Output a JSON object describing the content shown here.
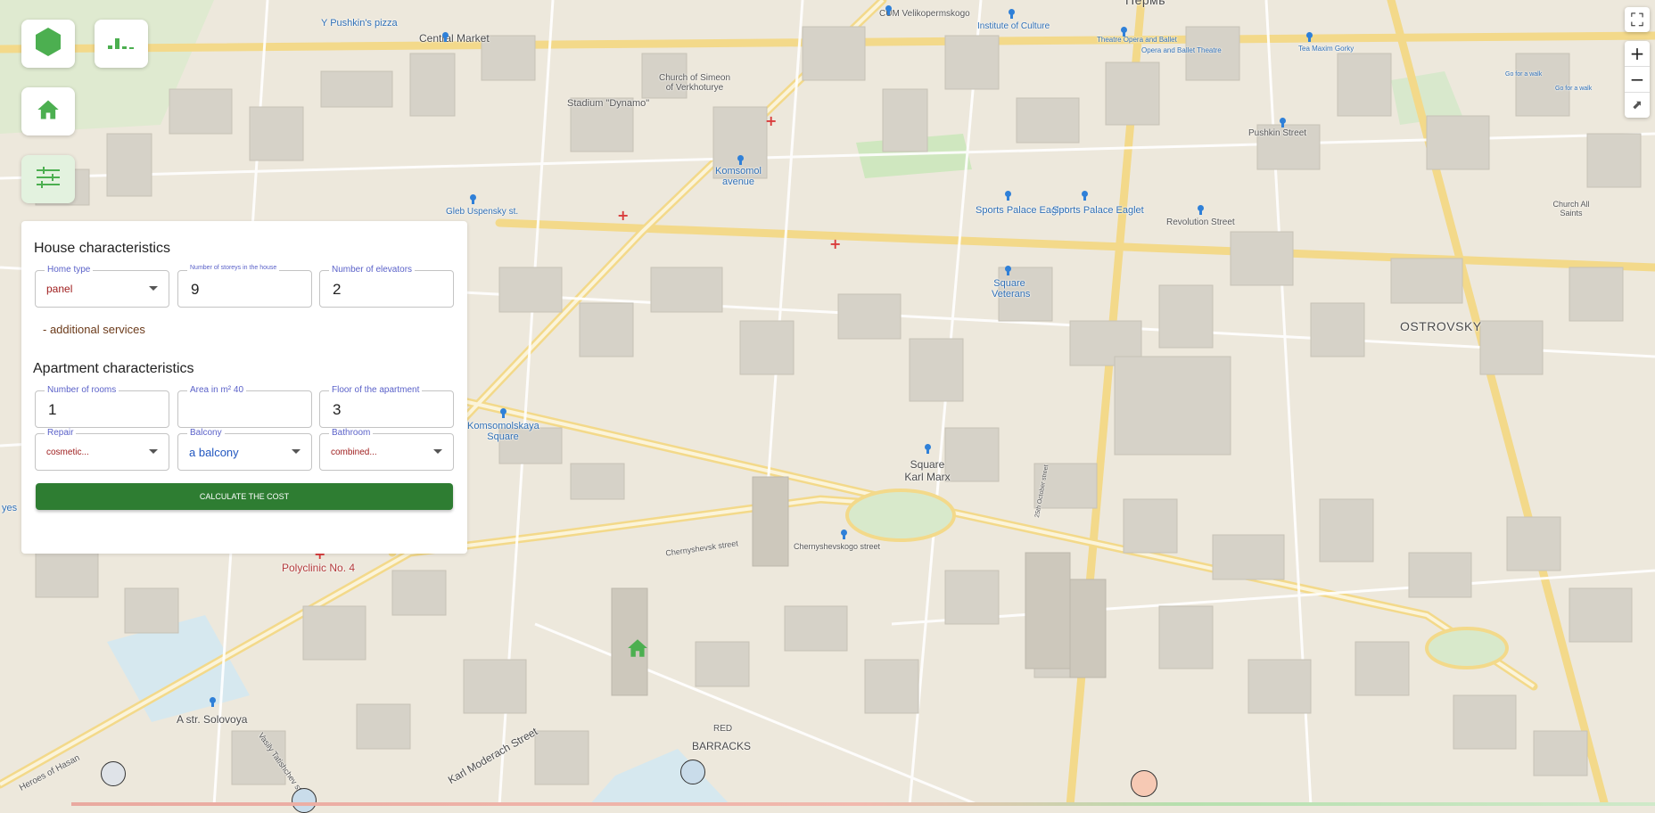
{
  "map": {
    "labels": {
      "yushkins_pizza": "Y Pushkin's pizza",
      "central_market": "Central Market",
      "cum": "CUM Velikopermskogo",
      "institute_culture": "Institute of Culture",
      "opera": "Theatre Opera and Ballet",
      "opera_ballet": "Opera and Ballet Theatre",
      "tea_maxim": "Tea Maxim Gorky",
      "go_for_walk_1": "Go for a walk",
      "go_for_walk_2": "Go for a walk",
      "church_simeon": "Church of Simeon of Verkhoturye",
      "stadium": "Stadium \"Dynamo\"",
      "komsomol_avenue": "Komsomol avenue",
      "pushkin_street": "Pushkin Street",
      "gleb": "Gleb Uspensky st.",
      "sports_palace_1": "Sports Palace Eaglet",
      "sports_palace_2": "Sports Palace Eaglet",
      "revolution_street": "Revolution Street",
      "church_all_saints": "Church All Saints",
      "square_veterans": "Square Veterans",
      "ostrovsky": "OSTROVSKY",
      "komsomolskaya": "Komsomolskaya Square",
      "square_karl_marx": "Square Karl Marx",
      "chernyshevsk": "Chernyshevsk street",
      "chernyshevskogo": "Chernyshevskogo street",
      "polyclinic": "Polyclinic No. 4",
      "a_str_solovoya": "A str. Solovoya",
      "vasily_tatishchev": "Vasily Tatishchev street",
      "karl_moderach": "Karl Moderach Street",
      "heroes_hasan": "Heroes of Hasan",
      "red_barracks_1": "RED",
      "red_barracks_2": "BARRACKS",
      "yes": "yes",
      "street_25oct": "25th October street",
      "top_cut": "Пермь"
    }
  },
  "toolbar": {
    "logo_icon": "hexagon-icon",
    "chart_icon": "bar-chart-icon",
    "home_icon": "home-icon",
    "filter_icon": "sliders-icon"
  },
  "map_controls": {
    "fullscreen": "⛶",
    "zoom_in": "+",
    "zoom_out": "−",
    "compass": "⬈"
  },
  "panel": {
    "house_title": "House characteristics",
    "home_type_label": "Home type",
    "home_type_value": "panel",
    "storeys_label": "Number of storeys in the house",
    "storeys_value": "9",
    "elevators_label": "Number of elevators",
    "elevators_value": "2",
    "additional_services": "- additional services",
    "apartment_title": "Apartment characteristics",
    "rooms_label": "Number of rooms",
    "rooms_value": "1",
    "area_label": "Area in m² 40",
    "area_value": "",
    "floor_label": "Floor of the apartment",
    "floor_value": "3",
    "repair_label": "Repair",
    "repair_value": "cosmetic...",
    "balcony_label": "Balcony",
    "balcony_value": "a balcony",
    "bathroom_label": "Bathroom",
    "bathroom_value": "combined...",
    "calculate_label": "CALCULATE THE COST"
  },
  "colors": {
    "accent_green": "#2e7d32",
    "icon_green": "#4caf50",
    "label_purple": "#5b62c9",
    "select_red": "#a02020",
    "select_blue": "#2257c0"
  }
}
